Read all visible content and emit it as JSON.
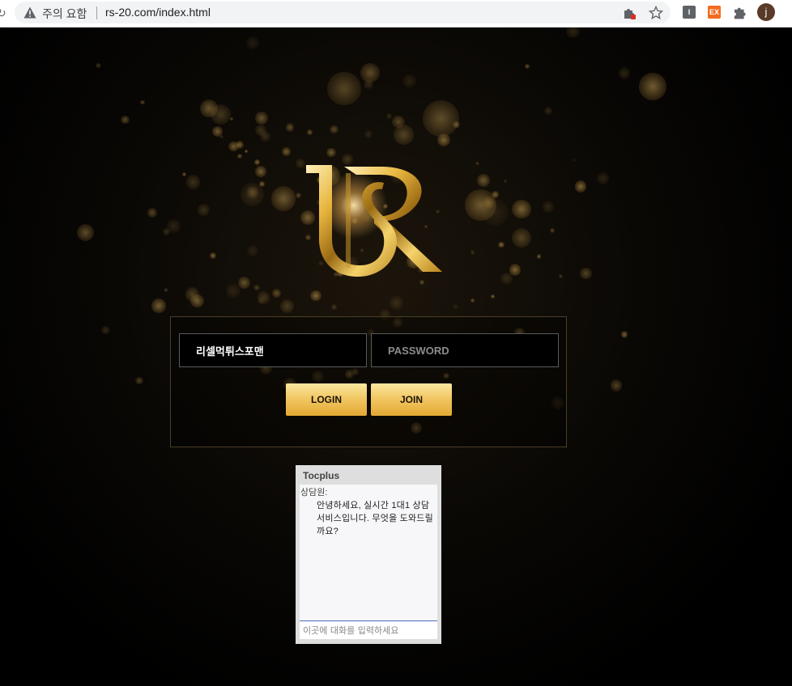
{
  "browser": {
    "security_label": "주의 요함",
    "url": "rs-20.com/index.html",
    "extension_ex_label": "EX",
    "extension_i_label": "I",
    "profile_initial": "j"
  },
  "login": {
    "username_value": "리셀먹튀스포맨",
    "password_placeholder": "PASSWORD",
    "login_label": "LOGIN",
    "join_label": "JOIN"
  },
  "chat": {
    "title": "Tocplus",
    "sender": "상담원:",
    "message": "안녕하세요, 실시간 1대1 상담 서비스입니다. 무엇을 도와드릴까요?",
    "input_placeholder": "이곳에 대화를 입력하세요"
  },
  "colors": {
    "gold": "#f2c865",
    "background": "#000000"
  }
}
